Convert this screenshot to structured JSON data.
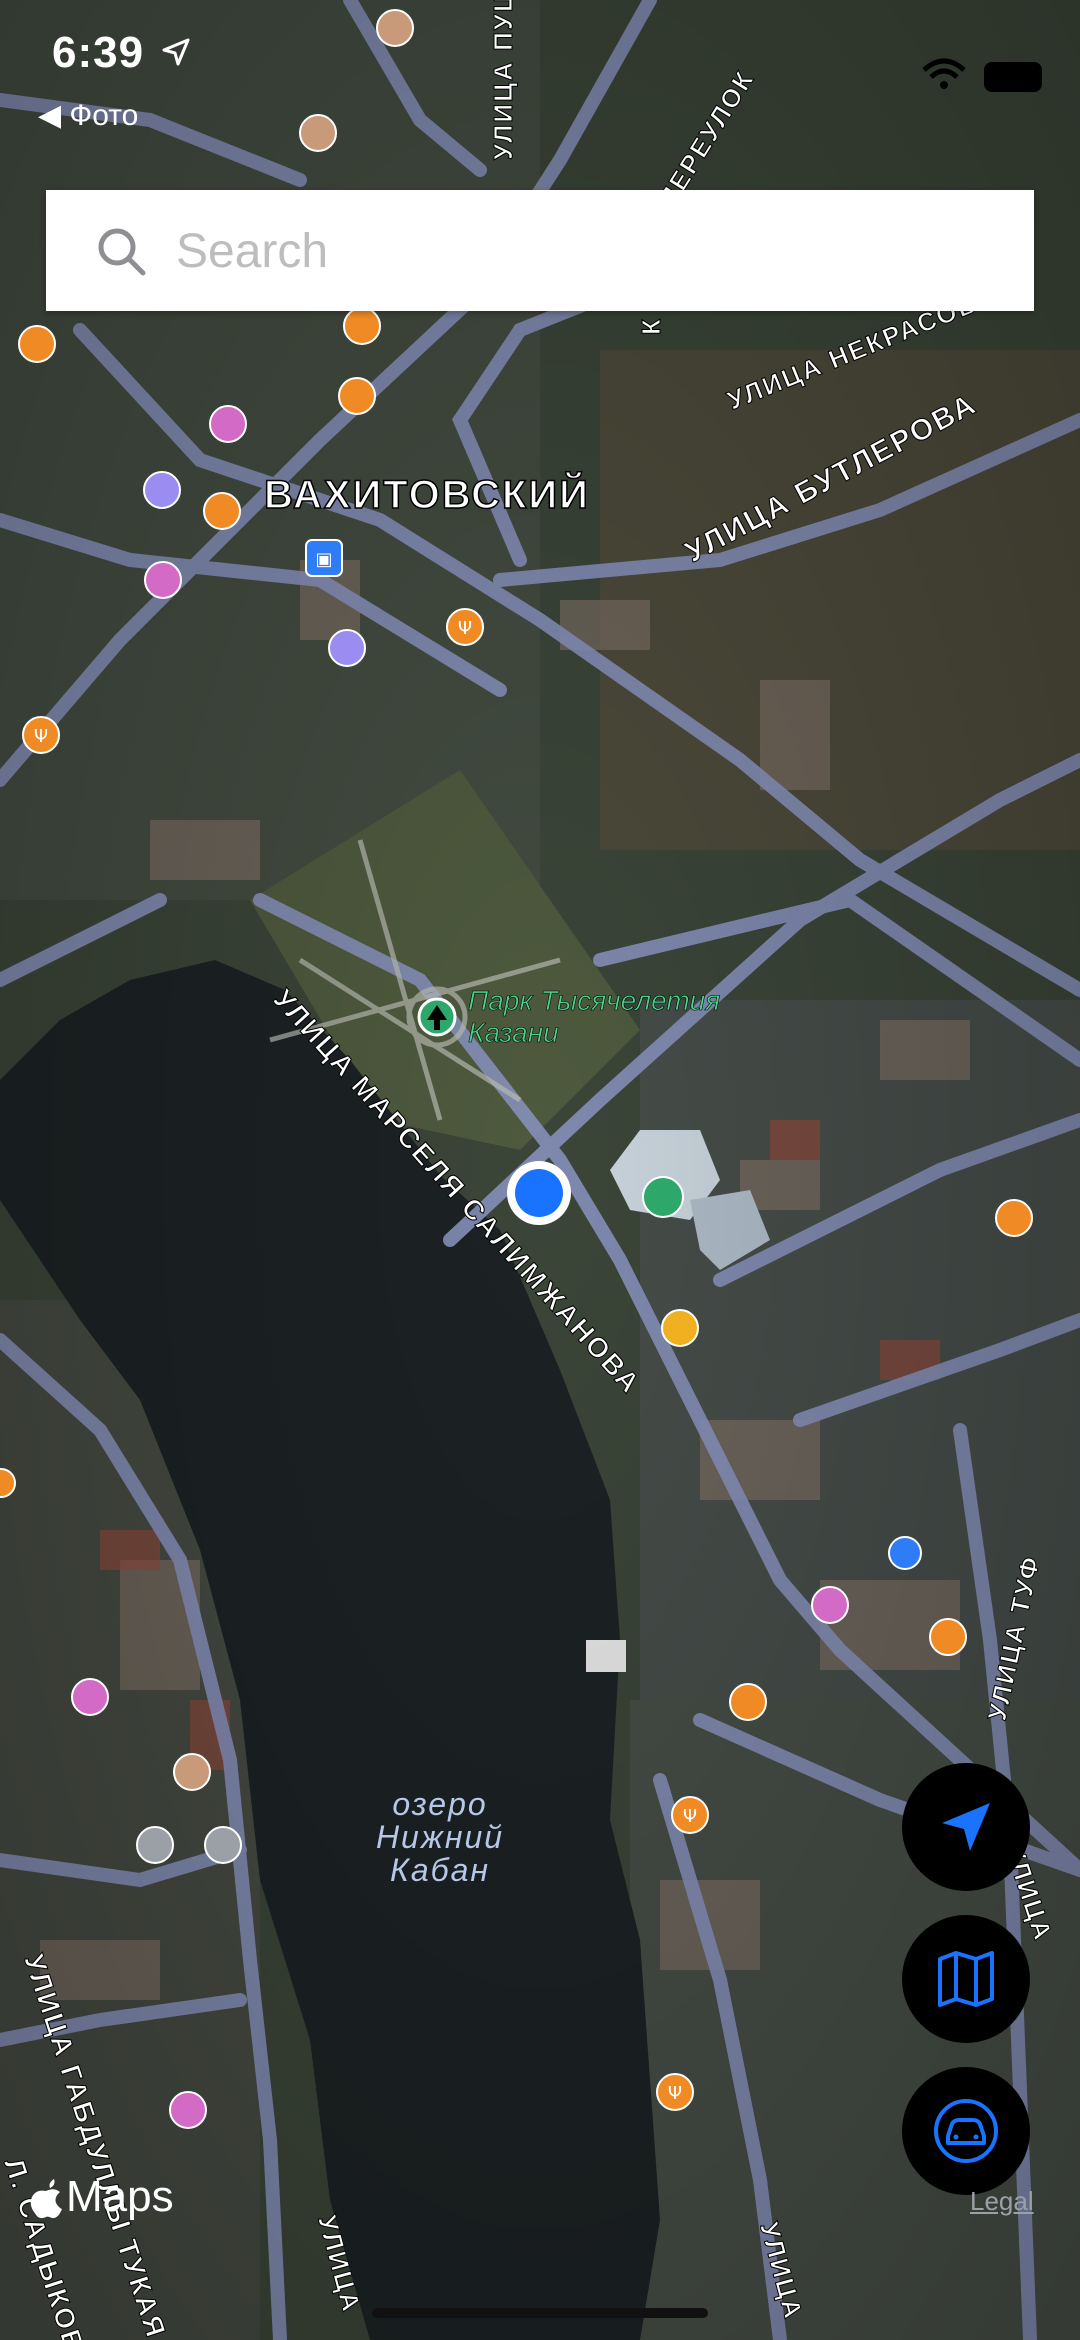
{
  "status_bar": {
    "time": "6:39",
    "back_app": "◀ Фото"
  },
  "search": {
    "placeholder": "Search"
  },
  "map": {
    "district": "ВАХИТОВСКИЙ",
    "park": [
      "Парк Тысячелетия",
      "Казани"
    ],
    "lake": [
      "озеро",
      "Нижний",
      "Кабан"
    ],
    "streets": {
      "pushkina": "УЛИЦА ПУШКИ",
      "pereulok": "ПЕРЕУЛОК",
      "nekrasova": "УЛИЦА НЕКРАСОВА",
      "butlerova": "УЛИЦА БУТЛЕРОВА",
      "salimzhanova": "УЛИЦА МАРСЕЛЯ САЛИМЖАНОВА",
      "tukaya": "УЛИЦА ГАБДУЛЛЫ ТУКАЯ",
      "sadykova": "Л. САДЫКОВА",
      "tuf": "УЛИЦА ТУФ",
      "bottom_left": "УЛИЦА",
      "bottom_right": "УЛИЦА",
      "right_edge": "УЛИЦА",
      "k_vertical": "К"
    }
  },
  "buttons": {
    "locate": "current-location",
    "map_mode": "map-view",
    "transport": "driving-mode"
  },
  "footer": {
    "brand": "Maps",
    "legal": "Legal"
  },
  "colors": {
    "user_location": "#1a73ff",
    "park_green": "#2ea86a",
    "poi_orange": "#f08a24",
    "poi_pink": "#d26ac6",
    "poi_purple": "#9a8cf0",
    "poi_blue": "#2f7df6",
    "accent_blue": "#1a73ff"
  }
}
